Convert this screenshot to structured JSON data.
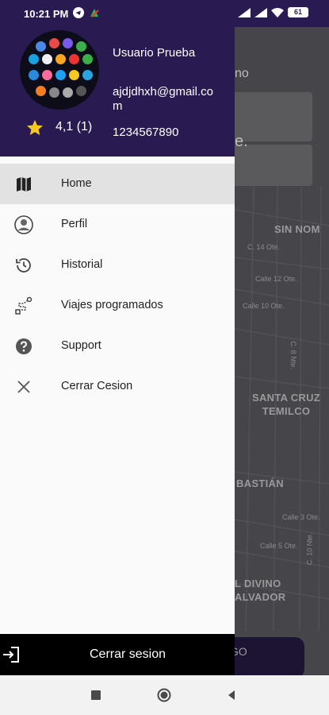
{
  "status_bar": {
    "time": "10:21 PM",
    "battery": "61"
  },
  "map": {
    "origin_partial": "no",
    "destination_partial": "e.",
    "areas": [
      {
        "label": "SIN NOM"
      },
      {
        "label": "SANTA CRUZ\nTEMILCO"
      },
      {
        "label": "BASTIÁN"
      },
      {
        "label": "L DIVINO\nALVADOR"
      }
    ],
    "streets": [
      "C. 14 Ote.",
      "Calle 12 Ote.",
      "Calle 10 Ote.",
      "C. 8 Nte.",
      "Calle 3 Ote.",
      "Calle 5 Ote.",
      "C. 10 Nte."
    ],
    "button_partial": "GO"
  },
  "drawer": {
    "user": {
      "name": "Usuario Prueba",
      "email": "ajdjdhxh@gmail.com",
      "phone": "1234567890",
      "rating": "4,1 (1)"
    },
    "menu": [
      {
        "label": "Home",
        "icon": "map-icon",
        "active": true
      },
      {
        "label": "Perfil",
        "icon": "person-icon",
        "active": false
      },
      {
        "label": "Historial",
        "icon": "history-icon",
        "active": false
      },
      {
        "label": "Viajes programados",
        "icon": "route-icon",
        "active": false
      },
      {
        "label": "Support",
        "icon": "help-icon",
        "active": false
      },
      {
        "label": "Cerrar Cesion",
        "icon": "close-icon",
        "active": false
      }
    ],
    "footer": {
      "label": "Cerrar sesion",
      "icon": "logout-icon"
    }
  },
  "colors": {
    "header": "#2a1a52",
    "drawer_bg": "#fafafa",
    "active_item": "#e2e2e2",
    "footer": "#000000",
    "star": "#f6c823"
  }
}
